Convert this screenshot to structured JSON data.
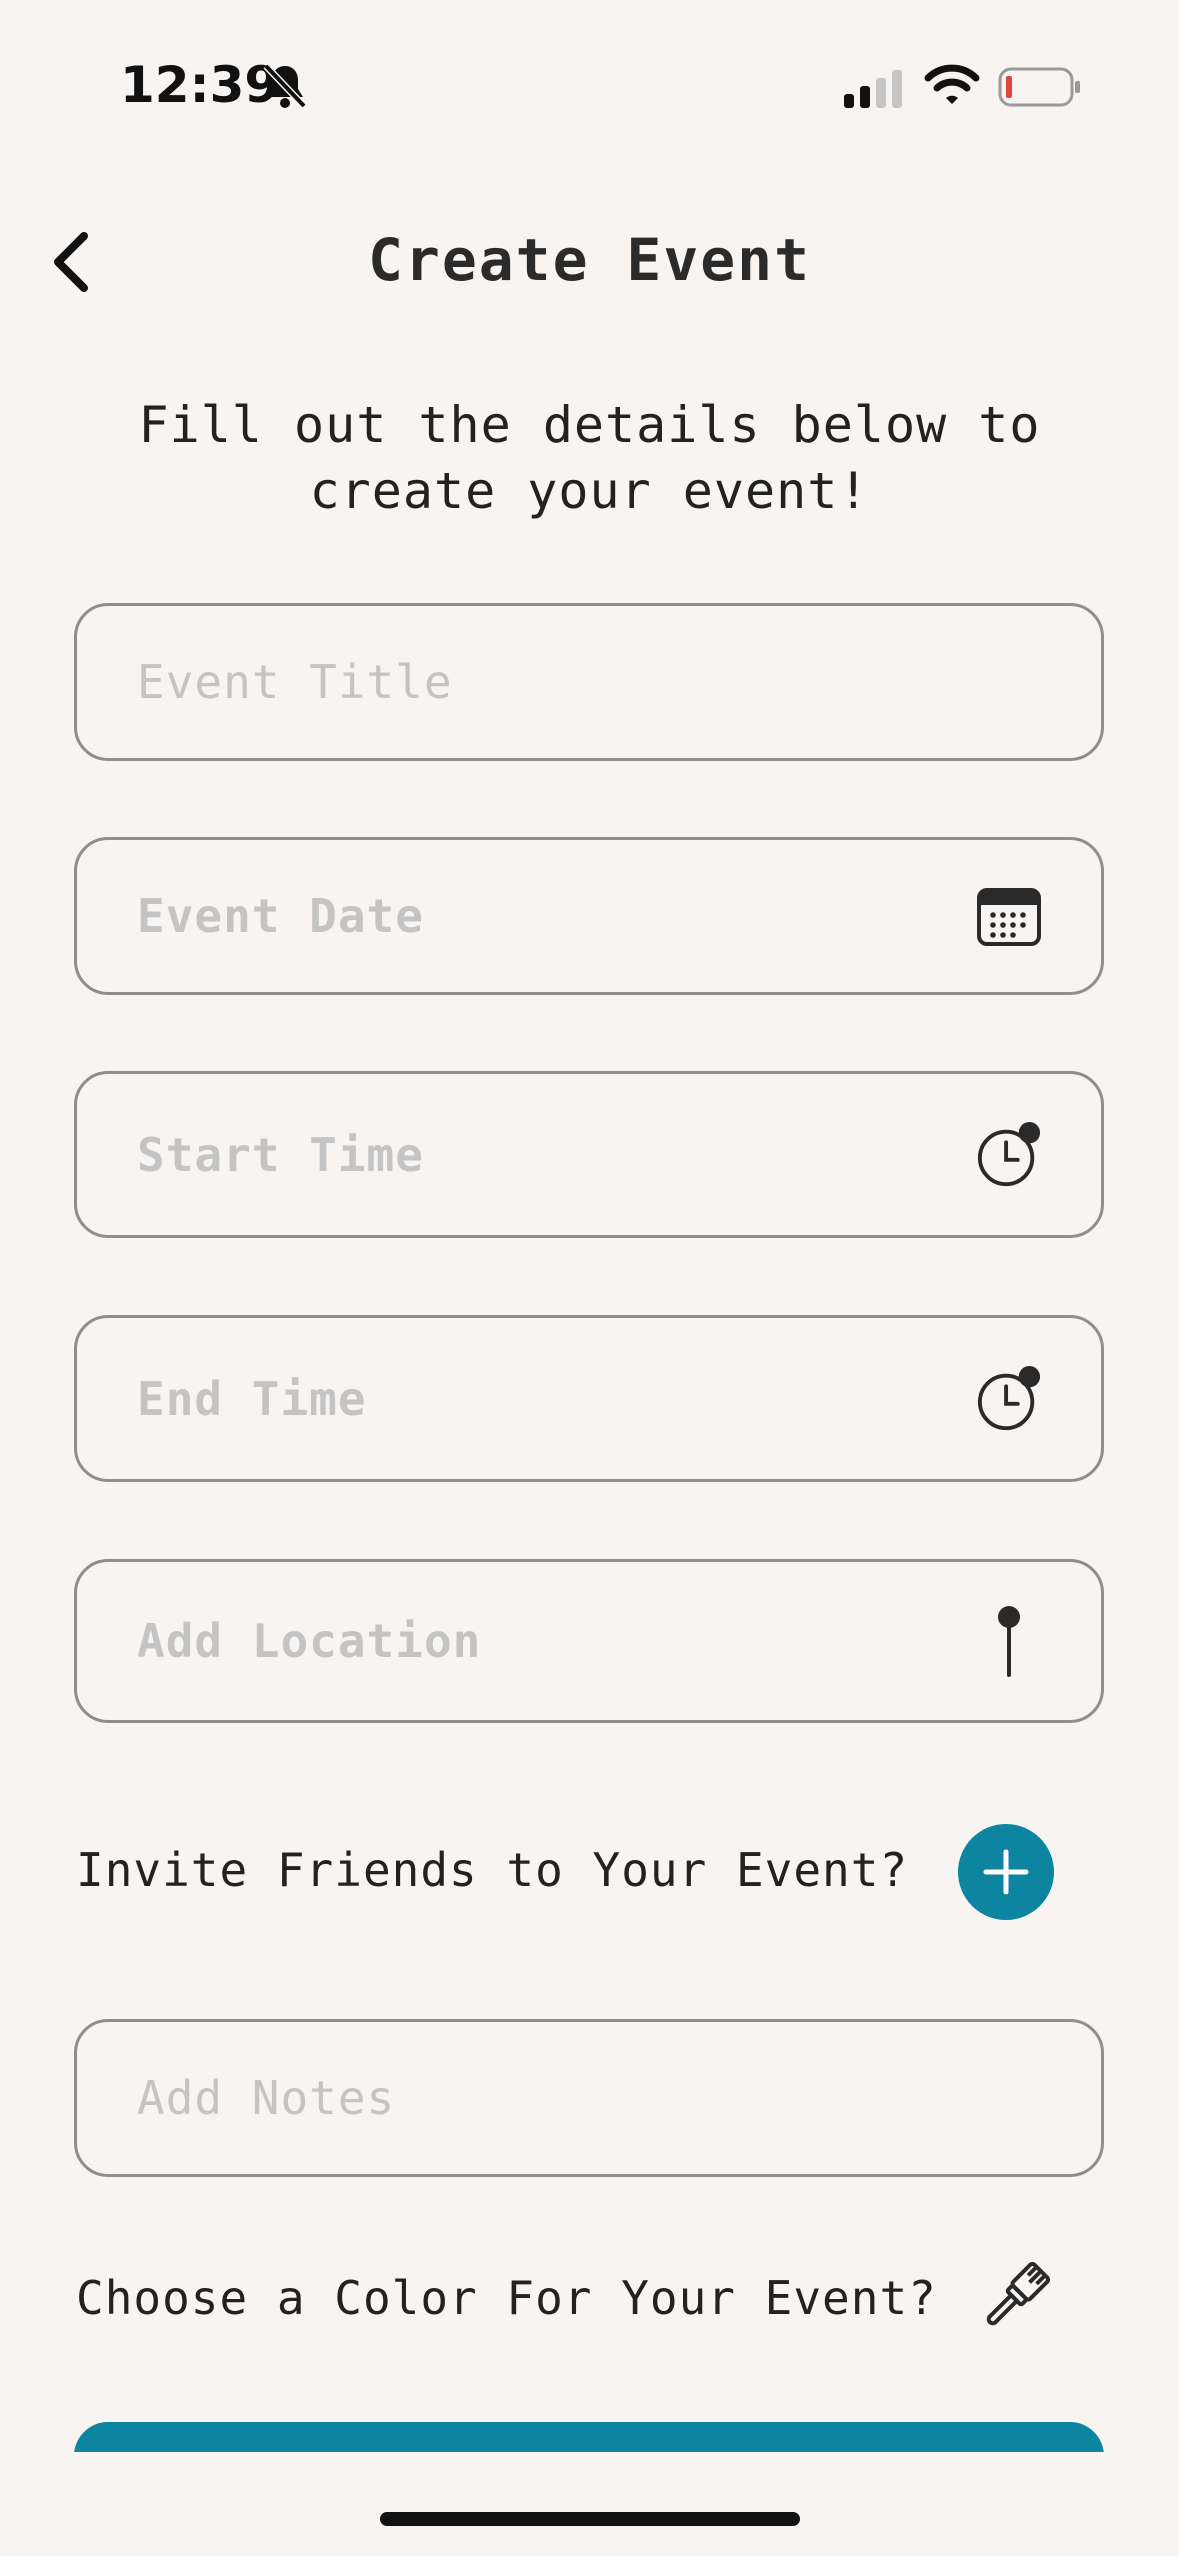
{
  "status_bar": {
    "time": "12:39",
    "icons": [
      "bell-slash-icon",
      "cellular-signal-icon",
      "wifi-icon",
      "battery-low-icon"
    ]
  },
  "nav": {
    "title": "Create Event",
    "back_icon": "chevron-left-icon"
  },
  "intro": {
    "line1": "Fill out the details below to",
    "line2": "create your event!"
  },
  "form": {
    "event_title": {
      "placeholder": "Event Title",
      "value": ""
    },
    "event_date": {
      "placeholder": "Event Date",
      "value": "",
      "icon": "calendar-icon"
    },
    "start_time": {
      "placeholder": "Start Time",
      "value": "",
      "icon": "clock-icon"
    },
    "end_time": {
      "placeholder": "End Time",
      "value": "",
      "icon": "clock-icon"
    },
    "location": {
      "placeholder": "Add Location",
      "value": "",
      "icon": "pin-icon"
    },
    "invite_label": "Invite Friends to Your Event?",
    "invite_icon": "plus-icon",
    "notes": {
      "placeholder": "Add Notes",
      "value": ""
    },
    "color_label": "Choose a Color For Your Event?",
    "color_icon": "paintbrush-icon"
  },
  "colors": {
    "accent": "#0e85a0",
    "background": "#f7f4f1",
    "field_border": "#8e8e8e",
    "placeholder": "#c4c4c4",
    "battery_low": "#e0463e"
  }
}
